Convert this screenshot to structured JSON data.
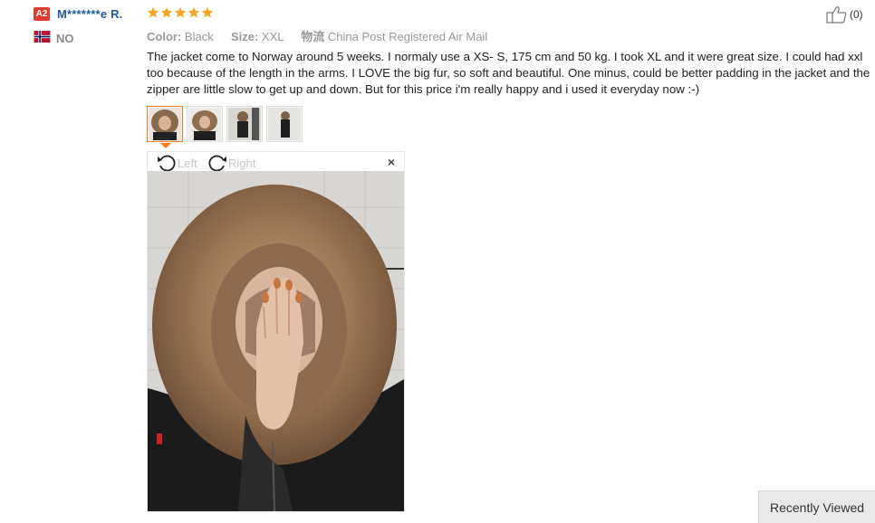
{
  "reviewer": {
    "level_badge": "A2",
    "name": "M*******e R.",
    "country_code": "NO",
    "flag_icon": "norway-flag-icon"
  },
  "rating": {
    "stars": 5,
    "max": 5,
    "star_color": "#f5a623"
  },
  "meta": {
    "color_label": "Color:",
    "color_value": "Black",
    "size_label": "Size:",
    "size_value": "XXL",
    "shipping_label": "物流",
    "shipping_value": "China Post Registered Air Mail"
  },
  "helpful": {
    "icon": "thumbs-up-icon",
    "count": "(0)"
  },
  "review_text": "The jacket come to Norway around 5 weeks. I normaly use a XS- S, 175 cm and 50 kg. I took XL and it were great size. I could had xxl too because of the length in the arms. I LOVE the big fur, so soft and beautiful. One minus, could be better padding in the jacket and the zipper are little slow to get up and down. But for this price i'm really happy and i used it everyday now :-)",
  "thumbnails": [
    {
      "name": "photo-1",
      "active": true
    },
    {
      "name": "photo-2",
      "active": false
    },
    {
      "name": "photo-3",
      "active": false
    },
    {
      "name": "photo-4",
      "active": false
    }
  ],
  "viewer": {
    "rotate_left_label": "Left",
    "rotate_right_label": "Right",
    "close_symbol": "×"
  },
  "recently_viewed": "Recently Viewed",
  "colors": {
    "accent": "#f57a1e",
    "link": "#1e5a9e",
    "badge": "#e23a2c"
  }
}
